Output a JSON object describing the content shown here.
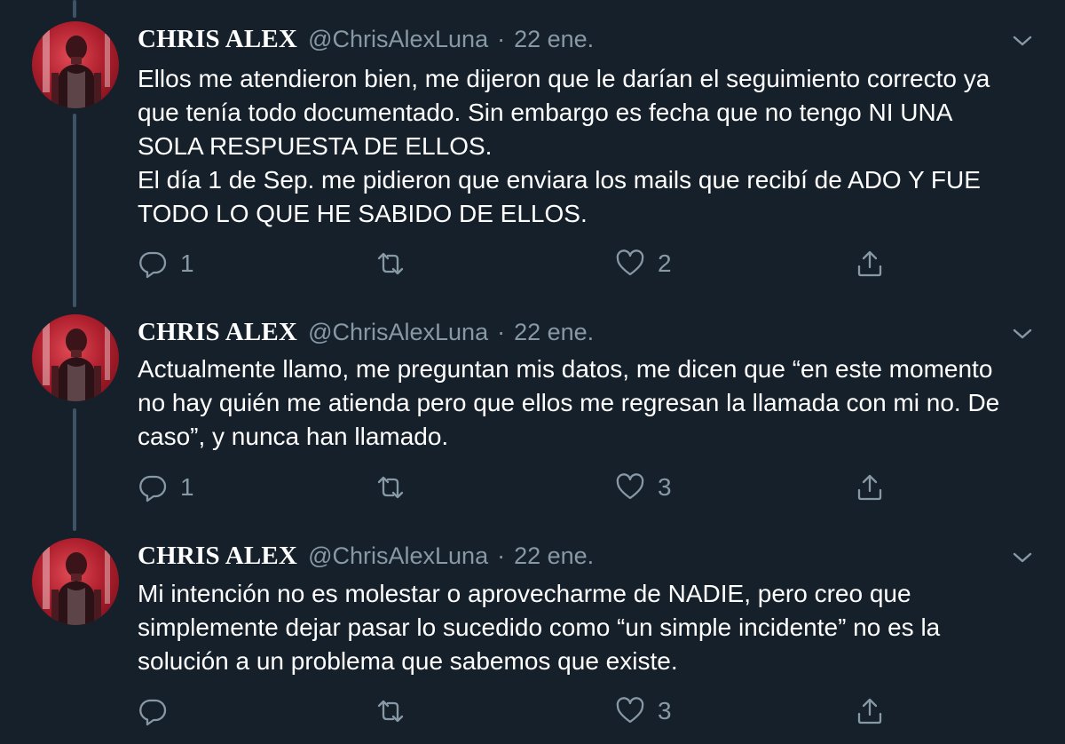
{
  "tweets": [
    {
      "display_name": "CHRIS ALEX",
      "handle": "@ChrisAlexLuna",
      "separator": "·",
      "date": "22 ene.",
      "lines": [
        "Ellos me atendieron bien, me dijeron que le darían el seguimiento correcto ya",
        "que tenía todo documentado. Sin embargo es fecha que no tengo NI UNA",
        "SOLA RESPUESTA DE ELLOS.",
        "El día 1 de Sep. me pidieron que enviara los mails que recibí de ADO Y FUE",
        "TODO LO QUE HE SABIDO DE ELLOS."
      ],
      "reply_count": "1",
      "retweet_count": "",
      "like_count": "2"
    },
    {
      "display_name": "CHRIS ALEX",
      "handle": "@ChrisAlexLuna",
      "separator": "·",
      "date": "22 ene.",
      "lines": [
        "Actualmente llamo, me preguntan mis datos, me dicen que “en este momento",
        "no hay quién me atienda pero que ellos me regresan la llamada con mi no. De",
        "caso”, y nunca han llamado."
      ],
      "reply_count": "1",
      "retweet_count": "",
      "like_count": "3"
    },
    {
      "display_name": "CHRIS ALEX",
      "handle": "@ChrisAlexLuna",
      "separator": "·",
      "date": "22 ene.",
      "lines": [
        "Mi intención no es molestar o aprovecharme de NADIE, pero creo que",
        "simplemente dejar pasar lo sucedido como “un simple incidente” no es la",
        "solución a un problema que sabemos que existe."
      ],
      "reply_count": "",
      "retweet_count": "",
      "like_count": "3"
    }
  ],
  "icons": {
    "reply": "reply-icon",
    "retweet": "retweet-icon",
    "like": "heart-icon",
    "share": "share-icon",
    "more": "chevron-down-icon"
  },
  "colors": {
    "background": "#15202b",
    "text": "#ffffff",
    "secondary_text": "#8899a6",
    "thread_line": "#3d5466"
  }
}
